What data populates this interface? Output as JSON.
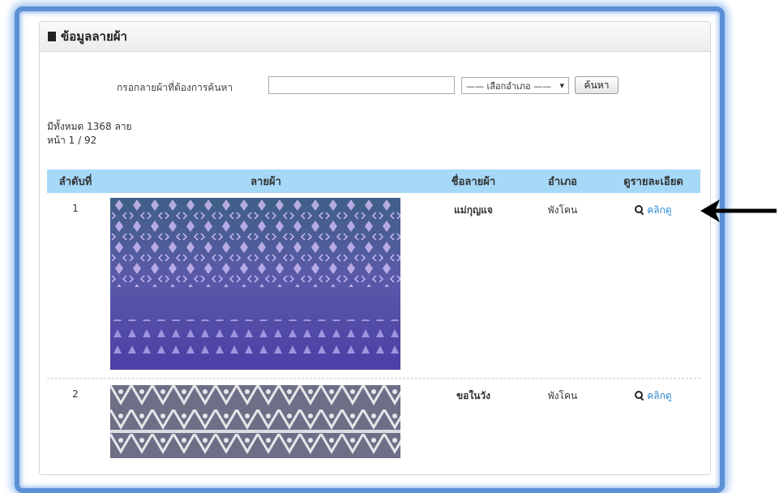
{
  "panel": {
    "title": "ข้อมูลลายผ้า"
  },
  "search": {
    "label": "กรอกลายผ้าที่ต้องการค้นหา",
    "input_value": "",
    "district_selected": "—— เลือกอำเภอ ——",
    "button_label": "ค้นหา"
  },
  "summary": {
    "total": "มีทั้งหมด 1368 ลาย",
    "page": "หน้า 1 / 92"
  },
  "table": {
    "headers": {
      "no": "ลำดับที่",
      "image": "ลายผ้า",
      "name": "ชื่อลายผ้า",
      "district": "อำเภอ",
      "detail": "ดูรายละเอียด"
    },
    "rows": [
      {
        "no": "1",
        "name": "แม่กุญแจ",
        "district": "พังโคน",
        "detail": "คลิกดู"
      },
      {
        "no": "2",
        "name": "ขอในวัง",
        "district": "พังโคน",
        "detail": "คลิกดู"
      }
    ]
  },
  "colors": {
    "frame": "#5b8fd6",
    "table_header": "#a6d8f8",
    "link": "#2b8bd6"
  },
  "icons": {
    "detail": "search-icon",
    "pointer": "arrow-left-icon"
  }
}
